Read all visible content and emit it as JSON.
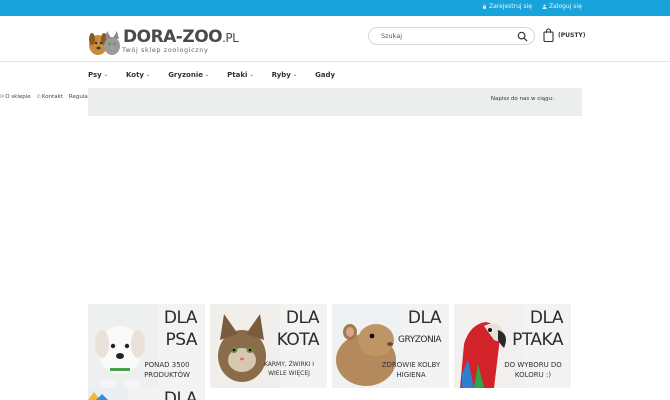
{
  "topbar": {
    "register_label": "Zarejestruj się",
    "login_label": "Zaloguj się",
    "color": "#18a3db"
  },
  "logo": {
    "brand": "DORA-ZOO",
    "suffix": ".PL",
    "tagline": "Twój sklep zoologiczny"
  },
  "search": {
    "placeholder": "Szukaj"
  },
  "cart": {
    "label": "(PUSTY)"
  },
  "nav": {
    "items": [
      {
        "label": "Psy",
        "dropdown": true
      },
      {
        "label": "Koty",
        "dropdown": true
      },
      {
        "label": "Gryzonie",
        "dropdown": true
      },
      {
        "label": "Ptaki",
        "dropdown": true
      },
      {
        "label": "Ryby",
        "dropdown": true
      },
      {
        "label": "Gady",
        "dropdown": false
      }
    ]
  },
  "infolinks": {
    "about": "O sklepie",
    "contact": "Kontakt",
    "terms": "Regula"
  },
  "contactbox": {
    "text": "Napisz do nas w ciągu:"
  },
  "banners": [
    {
      "line1": "DLA",
      "line2": "PSA",
      "sub": "PONAD 3500 PRODUKTÓW",
      "icon": "dog-image",
      "bg": "#f2f2f2"
    },
    {
      "line1": "DLA",
      "line2": "KOTA",
      "sub": "KARMY, ŻWIRKI I WIELE WIĘCEJ",
      "icon": "cat-image",
      "bg": "#f2f2f2"
    },
    {
      "line1": "DLA",
      "line2": "GRYZONIA",
      "sub": "ZDROWIE KOLBY HIGIENA",
      "icon": "hamster-image",
      "bg": "#f2f2f2"
    },
    {
      "line1": "DLA",
      "line2": "PTAKA",
      "sub": "DO WYBORU DO KOLORU :)",
      "icon": "parrot-image",
      "bg": "#f2f2f2"
    }
  ],
  "banner_partial": {
    "line1": "DLA"
  }
}
